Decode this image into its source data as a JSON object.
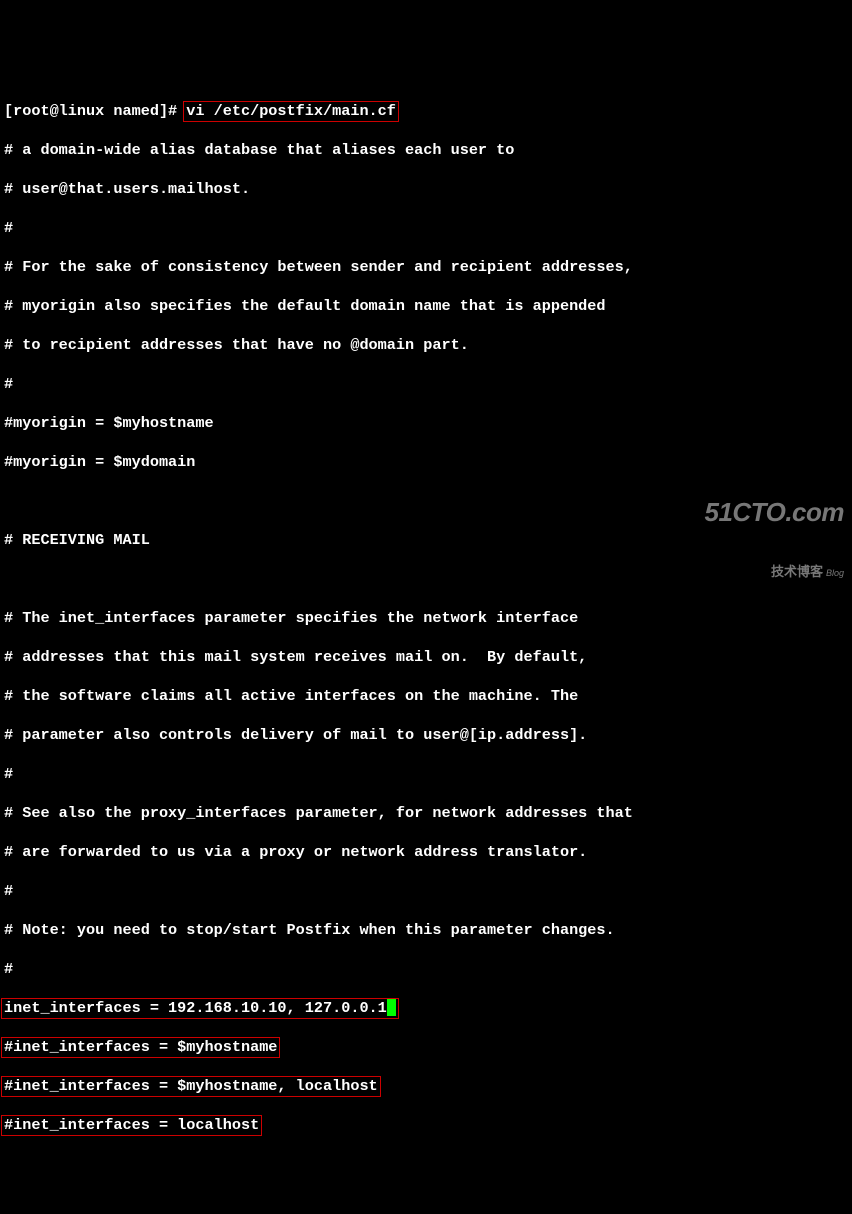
{
  "prompt": {
    "text": "[root@linux named]# ",
    "command": "vi /etc/postfix/main.cf"
  },
  "lines": [
    "# a domain-wide alias database that aliases each user to",
    "# user@that.users.mailhost.",
    "#",
    "# For the sake of consistency between sender and recipient addresses,",
    "# myorigin also specifies the default domain name that is appended",
    "# to recipient addresses that have no @domain part.",
    "#",
    "#myorigin = $myhostname",
    "#myorigin = $mydomain",
    "",
    "# RECEIVING MAIL",
    "",
    "# The inet_interfaces parameter specifies the network interface",
    "# addresses that this mail system receives mail on.  By default,",
    "# the software claims all active interfaces on the machine. The",
    "# parameter also controls delivery of mail to user@[ip.address].",
    "#",
    "# See also the proxy_interfaces parameter, for network addresses that",
    "# are forwarded to us via a proxy or network address translator.",
    "#",
    "# Note: you need to stop/start Postfix when this parameter changes.",
    "#"
  ],
  "boxed": {
    "active": "inet_interfaces = 192.168.10.10, 127.0.0.1",
    "rest": [
      "#inet_interfaces = $myhostname",
      "#inet_interfaces = $myhostname, localhost",
      "#inet_interfaces = localhost"
    ]
  },
  "watermark": {
    "top": "51CTO.com",
    "bot_main": "技术博客",
    "bot_blog": "Blog"
  }
}
